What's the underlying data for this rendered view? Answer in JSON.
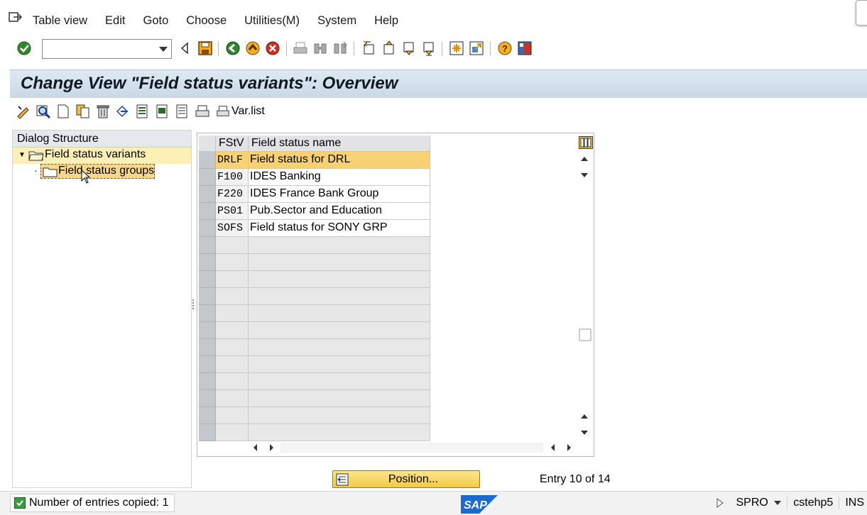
{
  "menu": {
    "items": [
      "Table view",
      "Edit",
      "Goto",
      "Choose",
      "Utilities(M)",
      "System",
      "Help"
    ]
  },
  "toolbar": {
    "command_field_value": "",
    "icons": [
      "enter-icon",
      "back-arrow-icon",
      "save-icon",
      "back-icon",
      "exit-icon",
      "cancel-icon",
      "print-icon",
      "find-icon",
      "find-next-icon",
      "first-page-icon",
      "previous-page-icon",
      "next-page-icon",
      "last-page-icon",
      "create-session-icon",
      "shortcut-icon",
      "help-icon",
      "layout-icon"
    ]
  },
  "title": "Change View \"Field status variants\": Overview",
  "app_toolbar": {
    "var_list_label": "Var.list"
  },
  "dialog_structure": {
    "header": "Dialog Structure",
    "items": [
      {
        "label": "Field status variants",
        "level": 0,
        "selected": true
      },
      {
        "label": "Field status groups",
        "level": 1,
        "focused": true
      }
    ]
  },
  "table": {
    "columns": [
      "FStV",
      "Field status name"
    ],
    "rows": [
      {
        "code": "DRLF",
        "name": "Field status for DRL",
        "highlighted": true
      },
      {
        "code": "F100",
        "name": "IDES Banking"
      },
      {
        "code": "F220",
        "name": "IDES France Bank Group"
      },
      {
        "code": "PS01",
        "name": "Pub.Sector and Education"
      },
      {
        "code": "SOFS",
        "name": "Field status for SONY GRP"
      }
    ],
    "empty_rows": 12
  },
  "position_button": "Position...",
  "entry_info": "Entry 10 of 14",
  "status": {
    "message": "Number of entries copied: 1",
    "transaction": "SPRO",
    "server": "cstehp5",
    "mode": "INS"
  },
  "colors": {
    "title_bg": "#c9d8e6",
    "selection": "#f8d272",
    "tree_selected": "#fdf0b7"
  }
}
